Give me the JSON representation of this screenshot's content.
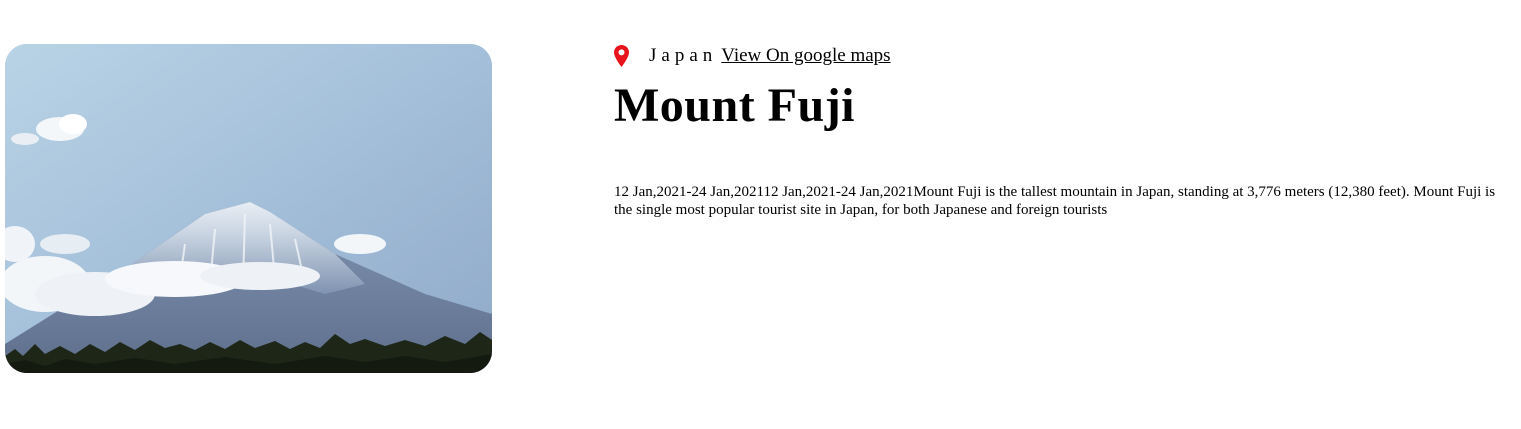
{
  "destination": {
    "image_alt": "Mount Fuji with snow cap above clouds",
    "location_icon": "map-pin-icon",
    "country": "Japan",
    "maps_link_label": "View On google maps",
    "title": "Mount Fuji",
    "date_range_1": "12 Jan,2021-24 Jan,2021",
    "date_range_2": "12 Jan,2021-24 Jan,2021",
    "description": "Mount Fuji is the tallest mountain in Japan, standing at 3,776 meters (12,380 feet). Mount Fuji is the single most popular tourist site in Japan, for both Japanese and foreign tourists"
  },
  "colors": {
    "pin": "#e8141b",
    "sky_top": "#a8c4dc",
    "sky_bottom": "#c8d8e6"
  }
}
